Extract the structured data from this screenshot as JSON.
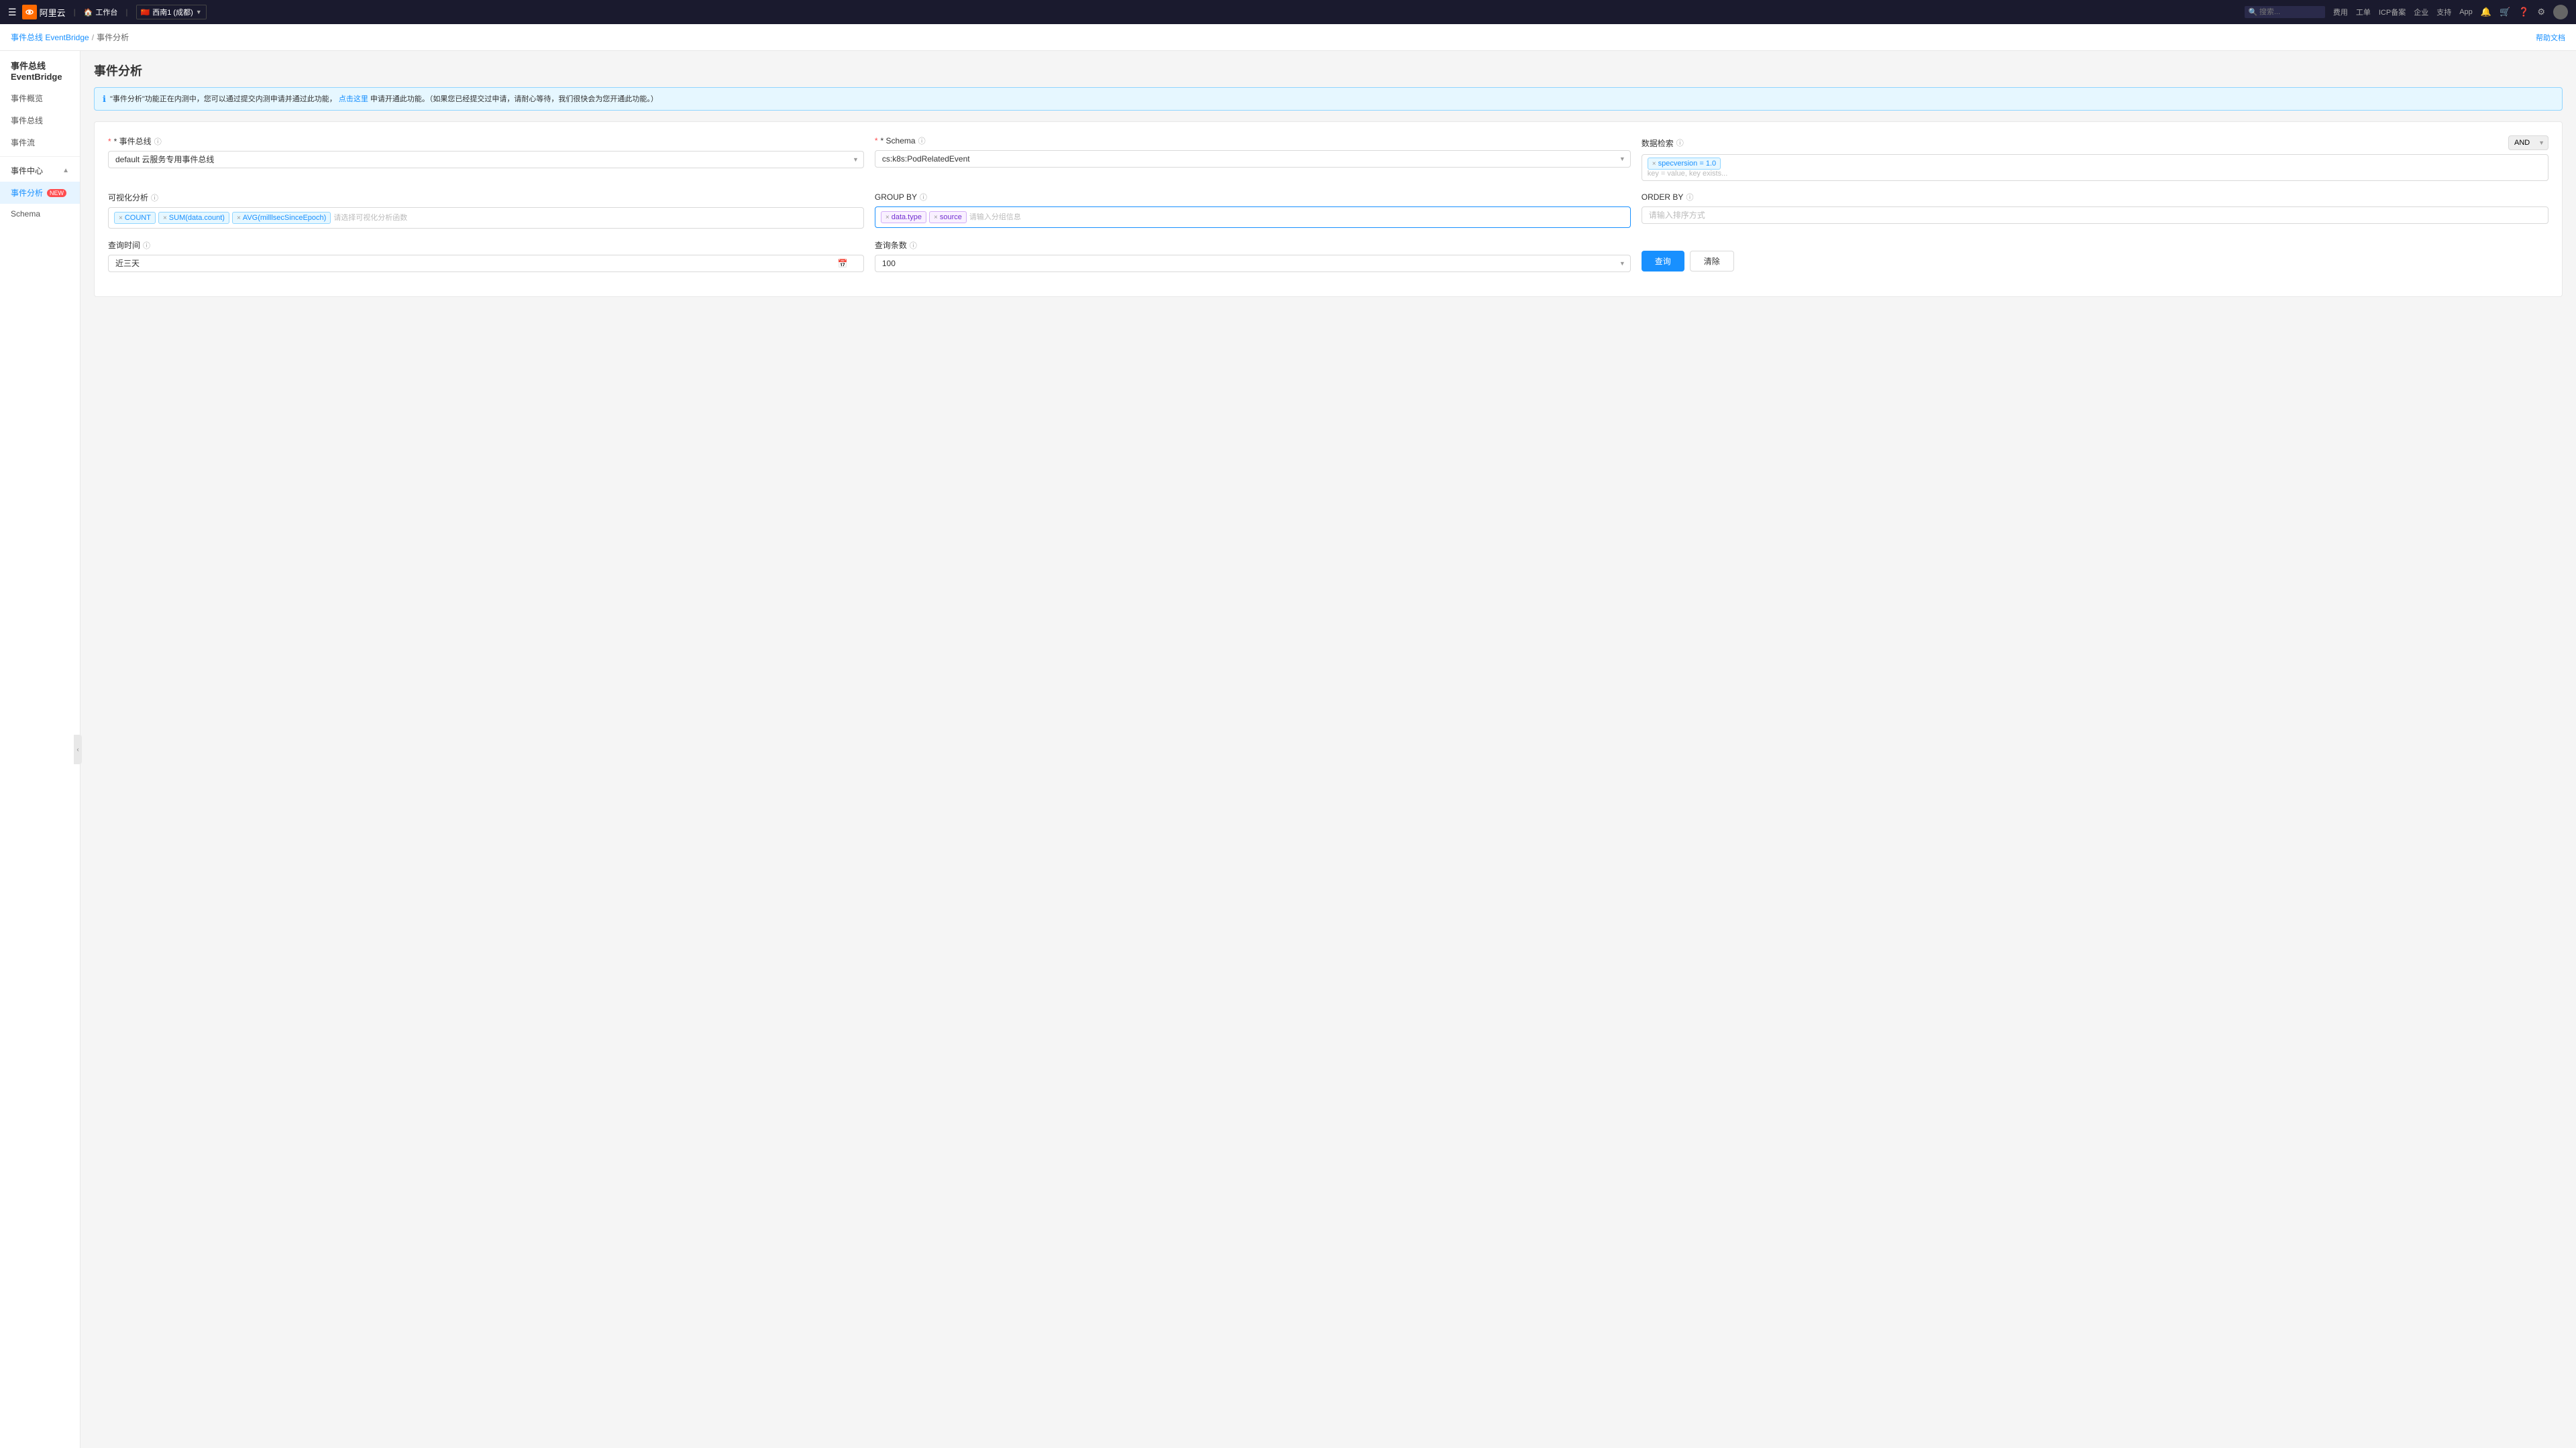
{
  "topnav": {
    "logo_text": "阿里云",
    "workbench_label": "工作台",
    "region_label": "西南1 (成都)",
    "region_icon": "🇨🇳",
    "search_placeholder": "搜索...",
    "nav_links": [
      "费用",
      "工单",
      "ICP备案",
      "企业",
      "支持",
      "App"
    ],
    "doc_link": "帮助文档"
  },
  "breadcrumb": {
    "items": [
      "事件总线 EventBridge",
      "事件分析"
    ],
    "separator": "/"
  },
  "sidebar": {
    "title": "事件总线 EventBridge",
    "menu_items": [
      "事件概览",
      "事件总线",
      "事件流"
    ],
    "section_header": "事件中心",
    "active_item": "事件分析",
    "new_badge": "NEW",
    "schema_item": "Schema"
  },
  "page": {
    "title": "事件分析",
    "info_text": "\"事件分析\"功能正在内测中，您可以通过提交内测申请并通过此功能，",
    "info_link_text": "点击这里",
    "info_text2": "申请开通此功能。（如果您已经提交过申请，请耐心等待，我们很快会为您开通此功能。）"
  },
  "form": {
    "event_bus_label": "* 事件总线",
    "event_bus_help": "ⓘ",
    "event_bus_value": "default  云服务专用事件总线",
    "schema_label": "* Schema",
    "schema_help": "ⓘ",
    "schema_value": "cs:k8s:PodRelatedEvent",
    "data_filter_label": "数据检索",
    "data_filter_help": "ⓘ",
    "data_filter_and": "AND",
    "data_filter_tag": "specversion = 1.0",
    "data_filter_placeholder": "key = value, key exists...",
    "visualization_label": "可视化分析",
    "visualization_help": "ⓘ",
    "viz_tags": [
      "COUNT",
      "SUM(data.count)",
      "AVG(milllsecSinceEpoch)"
    ],
    "viz_placeholder": "请选择可视化分析函数",
    "group_by_label": "GROUP BY",
    "group_by_help": "ⓘ",
    "group_by_tags": [
      "data.type",
      "source"
    ],
    "group_by_placeholder": "请输入分组信息",
    "order_by_label": "ORDER BY",
    "order_by_help": "ⓘ",
    "order_by_placeholder": "请输入排序方式",
    "query_time_label": "查询时间",
    "query_time_help": "ⓘ",
    "query_time_value": "近三天",
    "query_count_label": "查询条数",
    "query_count_help": "ⓘ",
    "query_count_value": "100",
    "query_button": "查询",
    "clear_button": "清除"
  }
}
